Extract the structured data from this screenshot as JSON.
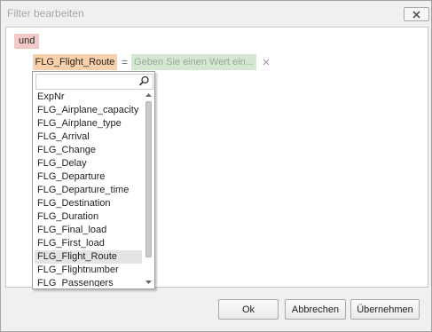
{
  "window": {
    "title": "Filter bearbeiten"
  },
  "filter": {
    "group_operator": "und",
    "condition": {
      "field": "FLG_Flight_Route",
      "operator": "=",
      "value_placeholder": "Geben Sie einen Wert ein..."
    }
  },
  "dropdown": {
    "items": [
      "ExpNr",
      "FLG_Airplane_capacity",
      "FLG_Airplane_type",
      "FLG_Arrival",
      "FLG_Change",
      "FLG_Delay",
      "FLG_Departure",
      "FLG_Departure_time",
      "FLG_Destination",
      "FLG_Duration",
      "FLG_Final_load",
      "FLG_First_load",
      "FLG_Flight_Route",
      "FLG_Flightnumber",
      "FLG_Passengers"
    ],
    "selected_item": "FLG_Flight_Route"
  },
  "buttons": {
    "ok": "Ok",
    "cancel": "Abbrechen",
    "apply": "Übernehmen"
  },
  "colors": {
    "group_chip": "#f3c8c8",
    "field_chip": "#f8d0ac",
    "value_chip": "#d4e7d0"
  }
}
